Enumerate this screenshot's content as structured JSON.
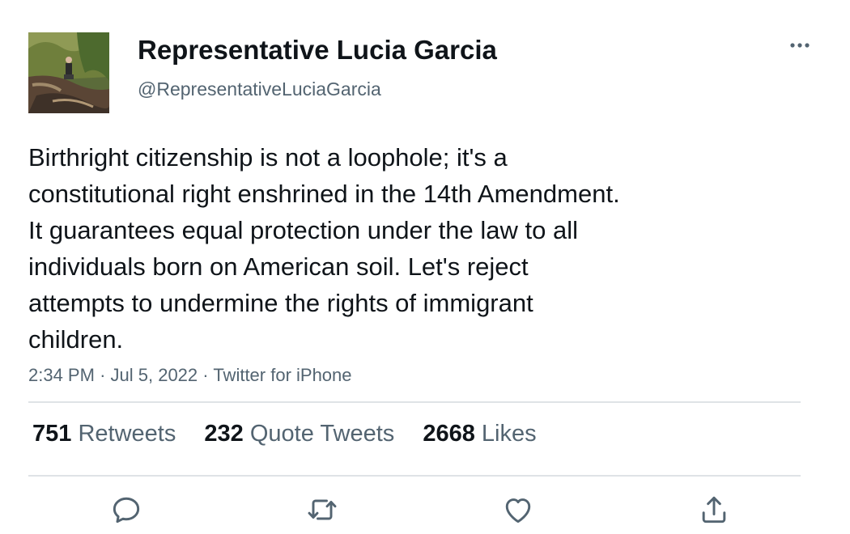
{
  "author": {
    "display_name": "Representative Lucia Garcia",
    "handle": "@RepresentativeLuciaGarcia",
    "avatar_icon": "profile-photo"
  },
  "tweet": {
    "lines": [
      "Birthright citizenship is not a loophole; it's a",
      "constitutional right enshrined in the 14th Amendment.",
      "It guarantees equal protection under the law to all",
      "individuals born on American soil. Let's reject",
      "attempts to undermine the rights of immigrant",
      "children."
    ],
    "time": "2:34 PM",
    "separator": "·",
    "date": "Jul 5, 2022",
    "source": "Twitter for iPhone"
  },
  "stats": {
    "retweets": {
      "count": "751",
      "label": "Retweets"
    },
    "quotes": {
      "count": "232",
      "label": "Quote Tweets"
    },
    "likes": {
      "count": "2668",
      "label": "Likes"
    }
  },
  "actions": {
    "icons": [
      "more-icon",
      "reply-icon",
      "retweet-icon",
      "like-icon",
      "share-icon"
    ]
  },
  "colors": {
    "text": "#0f1419",
    "secondary": "#536471",
    "divider": "#dfe3e6"
  }
}
